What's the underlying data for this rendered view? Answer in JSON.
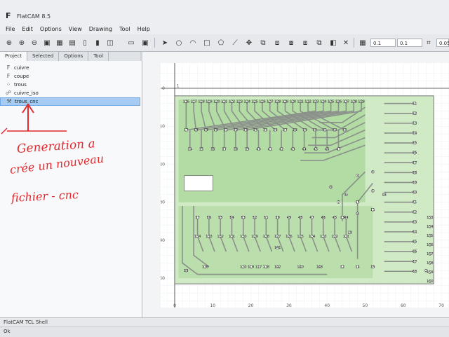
{
  "window": {
    "title": "FlatCAM 8.5"
  },
  "menu": [
    "File",
    "Edit",
    "Options",
    "View",
    "Drawing",
    "Tool",
    "Help"
  ],
  "toolbar": {
    "icons": [
      "zoom-fit-icon",
      "zoom-in-icon",
      "zoom-out-icon",
      "replot-icon",
      "clear-plot-icon",
      "new-geometry-icon",
      "delete-icon",
      "edit-geometry-icon",
      "shell-icon",
      "select-icon",
      "circle-icon",
      "arc-icon",
      "rectangle-icon",
      "polygon-icon",
      "path-icon",
      "move-icon",
      "copy-icon",
      "union-icon",
      "intersection-icon",
      "subtraction-icon",
      "cut-icon",
      "delete-shape-icon",
      "grid-icon"
    ],
    "grid_x": "0.1",
    "grid_y": "0.1",
    "snap_max": "0.05"
  },
  "tabs": [
    "Project",
    "Selected",
    "Options",
    "Tool"
  ],
  "active_tab": "Project",
  "objects": [
    {
      "name": "cuivre",
      "icon": "gerber-icon"
    },
    {
      "name": "coupe",
      "icon": "gerber-icon"
    },
    {
      "name": "trous",
      "icon": "excellon-icon"
    },
    {
      "name": "cuivre_iso",
      "icon": "geometry-icon"
    },
    {
      "name": "trous_cnc",
      "icon": "cnc-icon",
      "selected": true
    }
  ],
  "annotation": {
    "line1": "Generation a",
    "line2": "crée un nouveau",
    "line3": "fichier  - cnc",
    "color": "#e3292d"
  },
  "plot": {
    "x_ticks": [
      "0",
      "10",
      "20",
      "30",
      "40",
      "50",
      "60",
      "70"
    ],
    "y_ticks": [
      "0",
      "-10",
      "-20",
      "-30",
      "-40",
      "-50"
    ],
    "origin_marker": "1",
    "board_color": "#cfeac4",
    "copper_color": "#9bd08a",
    "trace_color": "#8a8f8a",
    "pad_labels": {
      "top_row": [
        "116",
        "117",
        "118",
        "119",
        "120",
        "121",
        "122",
        "123",
        "124",
        "125",
        "126",
        "127",
        "128",
        "129",
        "130",
        "131",
        "132",
        "133",
        "134",
        "135",
        "136",
        "137",
        "138",
        "139"
      ],
      "right_column": [
        "51",
        "52",
        "53",
        "54",
        "55",
        "56",
        "57",
        "58",
        "59",
        "60",
        "61",
        "62",
        "63",
        "64",
        "65",
        "66",
        "67",
        "68"
      ],
      "mid_row": [
        "17",
        "18",
        "19",
        "20",
        "21",
        "22",
        "23",
        "24",
        "25",
        "26",
        "27",
        "28",
        "29",
        "30",
        "31",
        "32",
        "33"
      ],
      "inner_row": [
        "34",
        "35",
        "36",
        "37",
        "38",
        "39",
        "40",
        "41",
        "42",
        "43",
        "44",
        "45",
        "46",
        "47"
      ],
      "bottom_block_top": [
        "57",
        "56",
        "55",
        "54",
        "53",
        "52",
        "51",
        "50",
        "49",
        "48",
        "47",
        "46",
        "45",
        "44"
      ],
      "bottom_block_mid": [
        "134",
        "133",
        "132",
        "131",
        "130",
        "129",
        "128",
        "127",
        "126",
        "125",
        "124",
        "123",
        "122",
        "121"
      ],
      "bottom_extra": [
        "141",
        "139",
        "142",
        "140",
        "148",
        "12",
        "14",
        "35"
      ],
      "right_lower": [
        "153",
        "154",
        "155",
        "156",
        "157",
        "158",
        "159",
        "160"
      ],
      "misc": [
        "2",
        "3",
        "4",
        "5",
        "6",
        "7",
        "8",
        "9",
        "10",
        "11",
        "13",
        "15",
        "16",
        "50",
        "120",
        "119",
        "117",
        "118"
      ]
    }
  },
  "status": {
    "shell": "FlatCAM TCL Shell",
    "message": "Ok"
  }
}
